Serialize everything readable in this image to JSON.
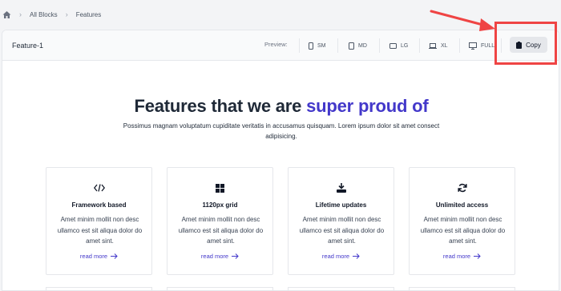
{
  "breadcrumb": {
    "items": [
      "All Blocks",
      "Features"
    ]
  },
  "toolbar": {
    "title": "Feature-1",
    "preview_label": "Preview:",
    "sizes": [
      "SM",
      "MD",
      "LG",
      "XL",
      "FULL"
    ],
    "copy_label": "Copy"
  },
  "hero": {
    "title_main": "Features that we are ",
    "title_accent": "super proud of",
    "subtitle": "Possimus magnam voluptatum cupiditate veritatis in accusamus quisquam. Lorem ipsum dolor sit amet consect adipisicing."
  },
  "features": [
    {
      "icon": "code-icon",
      "title": "Framework based",
      "desc": "Amet minim mollit non desc ullamco est sit aliqua dolor do amet sint.",
      "link": "read more"
    },
    {
      "icon": "grid-icon",
      "title": "1120px grid",
      "desc": "Amet minim mollit non desc ullamco est sit aliqua dolor do amet sint.",
      "link": "read more"
    },
    {
      "icon": "download-icon",
      "title": "Lifetime updates",
      "desc": "Amet minim mollit non desc ullamco est sit aliqua dolor do amet sint.",
      "link": "read more"
    },
    {
      "icon": "refresh-icon",
      "title": "Unlimited access",
      "desc": "Amet minim mollit non desc ullamco est sit aliqua dolor do amet sint.",
      "link": "read more"
    }
  ],
  "colors": {
    "accent": "#4338ca",
    "annotation": "#ef4444"
  }
}
